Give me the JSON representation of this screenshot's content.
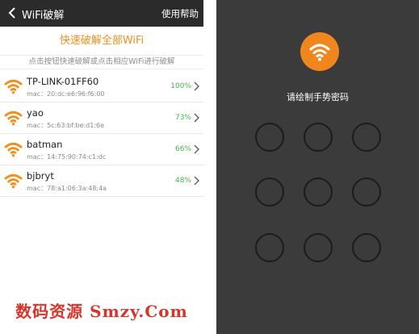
{
  "left_app": {
    "header": {
      "title": "WiFi破解",
      "help_label": "使用帮助"
    },
    "crack_all_label": "快速破解全部WiFi",
    "hint": "点击按钮快速破解或点击相应WiFi进行破解",
    "networks": [
      {
        "ssid": "TP-LINK-01FF60",
        "mac": "mac：20:dc:e6:96:f6:00",
        "percent": "100%"
      },
      {
        "ssid": "yao",
        "mac": "mac：5c:63:bf:be:d1:6e",
        "percent": "73%"
      },
      {
        "ssid": "batman",
        "mac": "mac：14:75:90:74:c1:dc",
        "percent": "66%"
      },
      {
        "ssid": "bjbryt",
        "mac": "mac：78:a1:06:3a:48:4a",
        "percent": "48%"
      }
    ],
    "colors": {
      "accent": "#f0901e",
      "percent": "#4caf50",
      "header_bg": "#2b2b2b"
    }
  },
  "right_app": {
    "prompt": "请绘制手势密码",
    "pattern_dot_count": 9,
    "colors": {
      "background": "#3b3b3b",
      "logo": "#f0861e"
    }
  },
  "watermark": "数码资源 Smzy.Com"
}
